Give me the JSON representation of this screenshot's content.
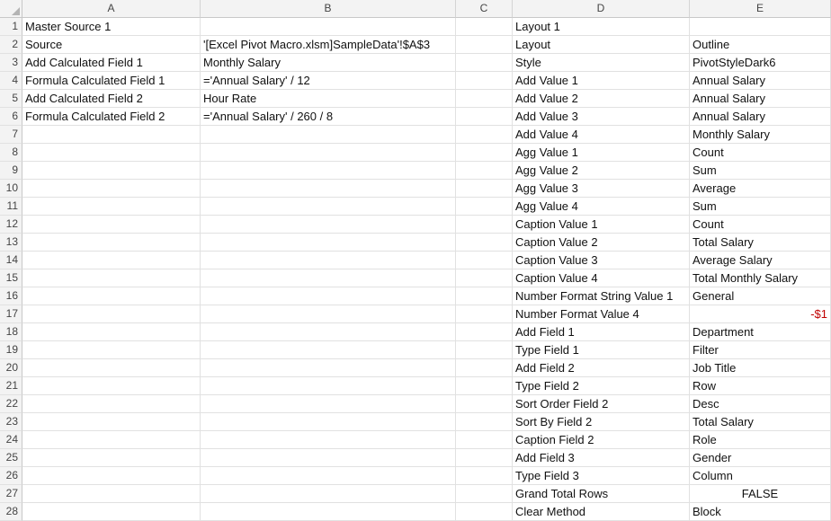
{
  "columns": [
    "A",
    "B",
    "C",
    "D",
    "E"
  ],
  "rows": [
    {
      "n": "1",
      "A": "Master Source 1",
      "B": "",
      "C": "",
      "D": "Layout 1",
      "E": ""
    },
    {
      "n": "2",
      "A": "Source",
      "B": "'[Excel Pivot Macro.xlsm]SampleData'!$A$3",
      "C": "",
      "D": "Layout",
      "E": "Outline"
    },
    {
      "n": "3",
      "A": "Add Calculated Field 1",
      "B": "Monthly Salary",
      "C": "",
      "D": "Style",
      "E": "PivotStyleDark6"
    },
    {
      "n": "4",
      "A": "Formula Calculated Field 1",
      "B": "='Annual Salary' / 12",
      "C": "",
      "D": "Add Value 1",
      "E": "Annual Salary"
    },
    {
      "n": "5",
      "A": "Add Calculated Field 2",
      "B": "Hour Rate",
      "C": "",
      "D": "Add Value 2",
      "E": "Annual Salary"
    },
    {
      "n": "6",
      "A": "Formula Calculated Field 2",
      "B": "='Annual Salary' / 260 / 8",
      "C": "",
      "D": "Add Value 3",
      "E": "Annual Salary"
    },
    {
      "n": "7",
      "A": "",
      "B": "",
      "C": "",
      "D": "Add Value 4",
      "E": "Monthly Salary"
    },
    {
      "n": "8",
      "A": "",
      "B": "",
      "C": "",
      "D": "Agg Value 1",
      "E": "Count"
    },
    {
      "n": "9",
      "A": "",
      "B": "",
      "C": "",
      "D": "Agg Value 2",
      "E": "Sum"
    },
    {
      "n": "10",
      "A": "",
      "B": "",
      "C": "",
      "D": "Agg Value 3",
      "E": "Average"
    },
    {
      "n": "11",
      "A": "",
      "B": "",
      "C": "",
      "D": "Agg Value 4",
      "E": "Sum"
    },
    {
      "n": "12",
      "A": "",
      "B": "",
      "C": "",
      "D": "Caption Value 1",
      "E": "Count"
    },
    {
      "n": "13",
      "A": "",
      "B": "",
      "C": "",
      "D": "Caption Value 2",
      "E": "Total Salary"
    },
    {
      "n": "14",
      "A": "",
      "B": "",
      "C": "",
      "D": "Caption Value 3",
      "E": "Average Salary"
    },
    {
      "n": "15",
      "A": "",
      "B": "",
      "C": "",
      "D": "Caption Value 4",
      "E": "Total Monthly Salary"
    },
    {
      "n": "16",
      "A": "",
      "B": "",
      "C": "",
      "D": "Number Format String Value 1",
      "E": "General"
    },
    {
      "n": "17",
      "A": "",
      "B": "",
      "C": "",
      "D": "Number Format Value 4",
      "E": "-$1"
    },
    {
      "n": "18",
      "A": "",
      "B": "",
      "C": "",
      "D": "Add Field 1",
      "E": "Department"
    },
    {
      "n": "19",
      "A": "",
      "B": "",
      "C": "",
      "D": "Type Field 1",
      "E": "Filter"
    },
    {
      "n": "20",
      "A": "",
      "B": "",
      "C": "",
      "D": "Add Field 2",
      "E": "Job Title"
    },
    {
      "n": "21",
      "A": "",
      "B": "",
      "C": "",
      "D": "Type Field 2",
      "E": "Row"
    },
    {
      "n": "22",
      "A": "",
      "B": "",
      "C": "",
      "D": "Sort Order Field 2",
      "E": "Desc"
    },
    {
      "n": "23",
      "A": "",
      "B": "",
      "C": "",
      "D": "Sort By Field 2",
      "E": "Total Salary"
    },
    {
      "n": "24",
      "A": "",
      "B": "",
      "C": "",
      "D": "Caption Field 2",
      "E": "Role"
    },
    {
      "n": "25",
      "A": "",
      "B": "",
      "C": "",
      "D": "Add Field 3",
      "E": "Gender"
    },
    {
      "n": "26",
      "A": "",
      "B": "",
      "C": "",
      "D": "Type Field 3",
      "E": "Column"
    },
    {
      "n": "27",
      "A": "",
      "B": "",
      "C": "",
      "D": "Grand Total Rows",
      "E": "FALSE"
    },
    {
      "n": "28",
      "A": "",
      "B": "",
      "C": "",
      "D": "Clear Method",
      "E": "Block"
    }
  ],
  "styles": {
    "negative_color": "#c00000",
    "selection_color": "#1e7145",
    "header_bg": "#f3f3f3"
  }
}
